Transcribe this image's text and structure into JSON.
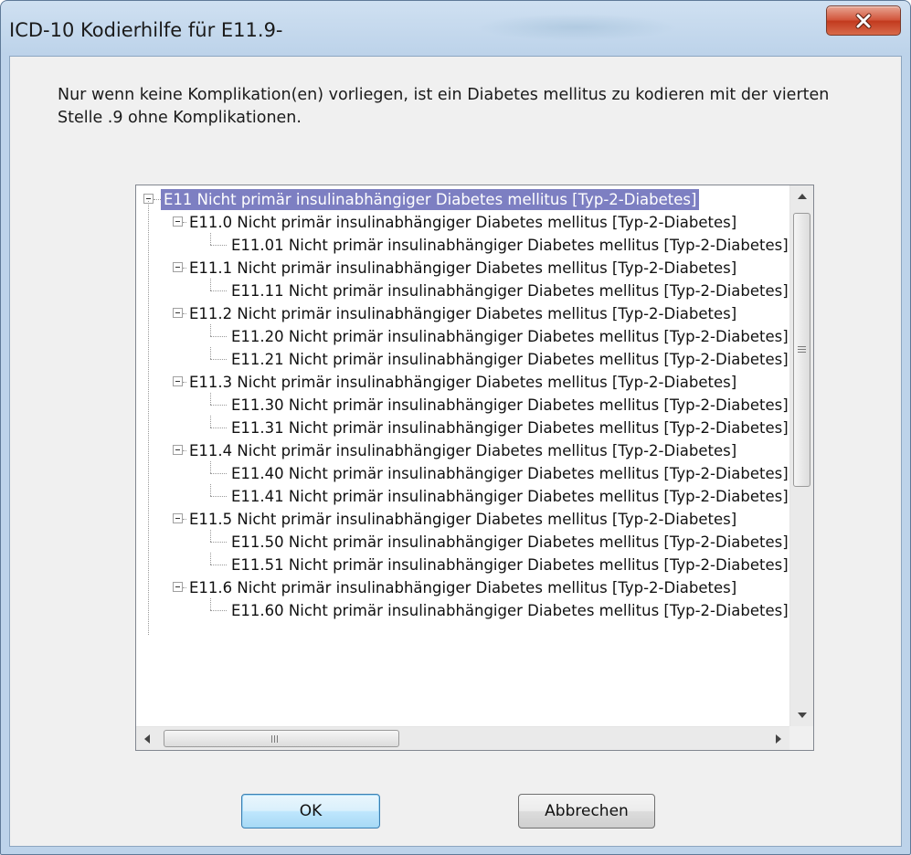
{
  "window": {
    "title": "ICD-10 Kodierhilfe für E11.9-",
    "close_icon": "close-x-icon"
  },
  "message": "Nur wenn keine Komplikation(en) vorliegen, ist ein Diabetes mellitus zu kodieren mit der vierten Stelle .9 ohne Komplikationen.",
  "tree": {
    "items": [
      {
        "label": "E11 Nicht primär insulinabhängiger Diabetes mellitus [Typ-2-Diabetes]",
        "level": 0,
        "expandable": true,
        "selected": true
      },
      {
        "label": "E11.0 Nicht primär insulinabhängiger Diabetes mellitus [Typ-2-Diabetes]",
        "level": 1,
        "expandable": true
      },
      {
        "label": "E11.01 Nicht primär insulinabhängiger Diabetes mellitus [Typ-2-Diabetes]",
        "level": 2,
        "expandable": false
      },
      {
        "label": "E11.1 Nicht primär insulinabhängiger Diabetes mellitus [Typ-2-Diabetes]",
        "level": 1,
        "expandable": true
      },
      {
        "label": "E11.11 Nicht primär insulinabhängiger Diabetes mellitus [Typ-2-Diabetes]",
        "level": 2,
        "expandable": false
      },
      {
        "label": "E11.2 Nicht primär insulinabhängiger Diabetes mellitus [Typ-2-Diabetes]",
        "level": 1,
        "expandable": true
      },
      {
        "label": "E11.20 Nicht primär insulinabhängiger Diabetes mellitus [Typ-2-Diabetes]",
        "level": 2,
        "expandable": false
      },
      {
        "label": "E11.21 Nicht primär insulinabhängiger Diabetes mellitus [Typ-2-Diabetes]",
        "level": 2,
        "expandable": false
      },
      {
        "label": "E11.3 Nicht primär insulinabhängiger Diabetes mellitus [Typ-2-Diabetes]",
        "level": 1,
        "expandable": true
      },
      {
        "label": "E11.30 Nicht primär insulinabhängiger Diabetes mellitus [Typ-2-Diabetes]",
        "level": 2,
        "expandable": false
      },
      {
        "label": "E11.31 Nicht primär insulinabhängiger Diabetes mellitus [Typ-2-Diabetes]",
        "level": 2,
        "expandable": false
      },
      {
        "label": "E11.4 Nicht primär insulinabhängiger Diabetes mellitus [Typ-2-Diabetes]",
        "level": 1,
        "expandable": true
      },
      {
        "label": "E11.40 Nicht primär insulinabhängiger Diabetes mellitus [Typ-2-Diabetes]",
        "level": 2,
        "expandable": false
      },
      {
        "label": "E11.41 Nicht primär insulinabhängiger Diabetes mellitus [Typ-2-Diabetes]",
        "level": 2,
        "expandable": false
      },
      {
        "label": "E11.5 Nicht primär insulinabhängiger Diabetes mellitus [Typ-2-Diabetes]",
        "level": 1,
        "expandable": true
      },
      {
        "label": "E11.50 Nicht primär insulinabhängiger Diabetes mellitus [Typ-2-Diabetes]",
        "level": 2,
        "expandable": false
      },
      {
        "label": "E11.51 Nicht primär insulinabhängiger Diabetes mellitus [Typ-2-Diabetes]",
        "level": 2,
        "expandable": false
      },
      {
        "label": "E11.6 Nicht primär insulinabhängiger Diabetes mellitus [Typ-2-Diabetes]",
        "level": 1,
        "expandable": true
      },
      {
        "label": "E11.60 Nicht primär insulinabhängiger Diabetes mellitus [Typ-2-Diabetes]",
        "level": 2,
        "expandable": false
      }
    ],
    "icons": {
      "collapse": "collapse-minus-icon",
      "scroll_up": "scroll-up-arrow-icon",
      "scroll_down": "scroll-down-arrow-icon",
      "scroll_left": "scroll-left-arrow-icon",
      "scroll_right": "scroll-right-arrow-icon"
    }
  },
  "buttons": {
    "ok_label": "OK",
    "cancel_label": "Abbrechen"
  },
  "colors": {
    "selection": "#7d7fc2",
    "close_button": "#c8432a",
    "default_button_border": "#3c7fb1"
  }
}
